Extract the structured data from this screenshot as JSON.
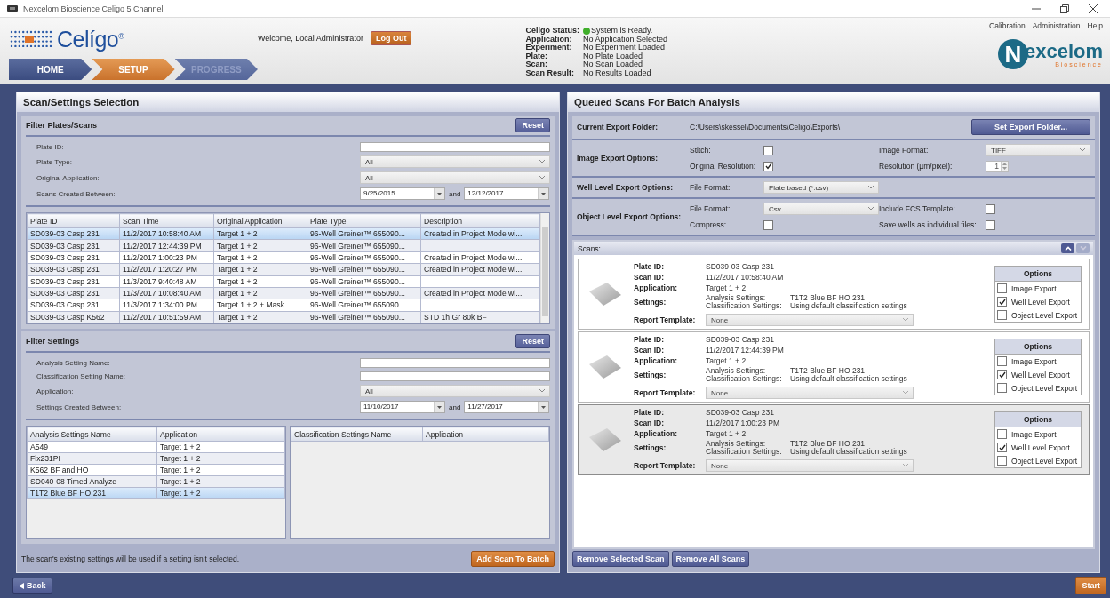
{
  "window": {
    "title": "Nexcelom Bioscience Celigo 5 Channel"
  },
  "header": {
    "logo": "Celígo",
    "logo_mark": "®",
    "welcome": "Welcome,  Local Administrator",
    "logout": "Log Out",
    "status": [
      {
        "label": "Celigo Status:",
        "value": "System is Ready.",
        "kind": "indicator",
        "color": "#3fae2a"
      },
      {
        "label": "Application:",
        "value": "No Application Selected",
        "kind": "plain"
      },
      {
        "label": "Experiment:",
        "value": "No Experiment Loaded",
        "kind": "plain"
      },
      {
        "label": "Plate:",
        "value": "No Plate Loaded",
        "kind": "plain"
      },
      {
        "label": "Scan:",
        "value": "No Scan Loaded",
        "kind": "plain"
      },
      {
        "label": "Scan Result:",
        "value": "No Results Loaded",
        "kind": "plain"
      }
    ],
    "menu": [
      "Calibration",
      "Administration",
      "Help"
    ],
    "brand": {
      "initial": "N",
      "rest": "excelom",
      "tagline": "Bioscience"
    },
    "tabs": [
      {
        "label": "HOME",
        "selected": false,
        "disabled": false
      },
      {
        "label": "SETUP",
        "selected": true,
        "disabled": false
      },
      {
        "label": "PROGRESS",
        "selected": false,
        "disabled": true
      }
    ]
  },
  "scan_selection": {
    "title": "Scan/Settings Selection",
    "plate_filter": {
      "title": "Filter Plates/Scans",
      "reset": "Reset",
      "fields": [
        {
          "label": "Plate ID:",
          "kind": "text"
        },
        {
          "label": "Plate Type:",
          "kind": "select",
          "value": "All"
        },
        {
          "label": "Original Application:",
          "kind": "select",
          "value": "All"
        },
        {
          "label": "Scans Created Between:",
          "kind": "daterange",
          "from": "9/25/2015",
          "joiner": "and",
          "to": "12/12/2017"
        }
      ],
      "columns": [
        "Plate ID",
        "Scan Time",
        "Original Application",
        "Plate Type",
        "Description"
      ],
      "rows": [
        {
          "cells": [
            "SD039-03 Casp 231",
            "11/2/2017 10:58:40 AM",
            "Target 1 + 2",
            "96-Well Greiner™ 655090...",
            "Created in Project Mode wi..."
          ],
          "selected": true
        },
        {
          "cells": [
            "SD039-03 Casp 231",
            "11/2/2017 12:44:39 PM",
            "Target 1 + 2",
            "96-Well Greiner™ 655090..."
          ],
          "selected": false
        },
        {
          "cells": [
            "SD039-03 Casp 231",
            "11/2/2017 1:00:23 PM",
            "Target 1 + 2",
            "96-Well Greiner™ 655090...",
            "Created in Project Mode wi..."
          ],
          "selected": false
        },
        {
          "cells": [
            "SD039-03 Casp 231",
            "11/2/2017 1:20:27 PM",
            "Target 1 + 2",
            "96-Well Greiner™ 655090...",
            "Created in Project Mode wi..."
          ],
          "selected": false
        },
        {
          "cells": [
            "SD039-03 Casp 231",
            "11/3/2017 9:40:48 AM",
            "Target 1 + 2",
            "96-Well Greiner™ 655090..."
          ],
          "selected": false
        },
        {
          "cells": [
            "SD039-03 Casp 231",
            "11/3/2017 10:08:40 AM",
            "Target 1 + 2",
            "96-Well Greiner™ 655090...",
            "Created in Project Mode wi..."
          ],
          "selected": false
        },
        {
          "cells": [
            "SD039-03 Casp 231",
            "11/3/2017 1:34:00 PM",
            "Target 1 + 2 + Mask",
            "96-Well Greiner™ 655090..."
          ],
          "selected": false
        },
        {
          "cells": [
            "SD039-03 Casp K562",
            "11/2/2017 10:51:59 AM",
            "Target 1 + 2",
            "96-Well Greiner™ 655090...",
            "STD 1h Gr 80k BF"
          ],
          "selected": false
        }
      ]
    },
    "settings_filter": {
      "title": "Filter Settings",
      "reset": "Reset",
      "fields": [
        {
          "label": "Analysis Setting Name:",
          "kind": "text"
        },
        {
          "label": "Classification Setting Name:",
          "kind": "text"
        },
        {
          "label": "Application:",
          "kind": "select",
          "value": "All"
        },
        {
          "label": "Settings Created Between:",
          "kind": "daterange",
          "from": "11/10/2017",
          "joiner": "and",
          "to": "11/27/2017"
        }
      ],
      "analysis_columns": [
        "Analysis Settings Name",
        "Application"
      ],
      "analysis_rows": [
        {
          "cells": [
            "A549",
            "Target 1 + 2"
          ],
          "selected": false
        },
        {
          "cells": [
            "Flx231PI",
            "Target 1 + 2"
          ],
          "selected": false
        },
        {
          "cells": [
            "K562 BF and HO",
            "Target 1 + 2"
          ],
          "selected": false
        },
        {
          "cells": [
            "SD040-08 Timed Analyze",
            "Target 1 + 2"
          ],
          "selected": false
        },
        {
          "cells": [
            "T1T2 Blue BF HO 231",
            "Target 1 + 2"
          ],
          "selected": true
        }
      ],
      "classification_columns": [
        "Classification Settings Name",
        "Application"
      ]
    },
    "note": "The scan's existing settings will be used if a setting isn't selected.",
    "add_button": "Add Scan To Batch"
  },
  "batch": {
    "title": "Queued Scans For Batch Analysis",
    "folder": {
      "label": "Current Export Folder:",
      "path": "C:\\Users\\skessel\\Documents\\Celigo\\Exports\\",
      "button": "Set Export Folder..."
    },
    "image_export": {
      "label": "Image Export Options:",
      "stitch": {
        "label": "Stitch:",
        "checked": false
      },
      "original_resolution": {
        "label": "Original Resolution:",
        "checked": true
      },
      "format": {
        "label": "Image Format:",
        "value": "TIFF"
      },
      "resolution": {
        "label": "Resolution (µm/pixel):",
        "value": "1"
      }
    },
    "well_export": {
      "label": "Well Level Export Options:",
      "format": {
        "label": "File Format:",
        "value": "Plate based (*.csv)"
      }
    },
    "object_export": {
      "label": "Object Level Export Options:",
      "format": {
        "label": "File Format:",
        "value": "Csv"
      },
      "fcs": {
        "label": "Include FCS Template:",
        "checked": false
      },
      "compress": {
        "label": "Compress:",
        "checked": false
      },
      "save_wells": {
        "label": "Save wells as individual files:",
        "checked": false
      }
    },
    "scans_title": "Scans:",
    "scans": [
      {
        "selected": false,
        "rows": [
          {
            "label": "Plate ID:",
            "value": "SD039-03 Casp 231"
          },
          {
            "label": "Scan ID:",
            "value": "11/2/2017 10:58:40 AM"
          },
          {
            "label": "Application:",
            "value": "Target 1 + 2"
          }
        ],
        "settings_label": "Settings:",
        "settings": [
          {
            "label": "Analysis Settings:",
            "value": "T1T2 Blue BF HO 231"
          },
          {
            "label": "Classification Settings:",
            "value": "Using default classification settings"
          }
        ],
        "report_label": "Report Template:",
        "report": "None",
        "options_title": "Options",
        "options": [
          {
            "label": "Image Export",
            "checked": false
          },
          {
            "label": "Well Level Export",
            "checked": true
          },
          {
            "label": "Object Level Export",
            "checked": false
          }
        ]
      },
      {
        "selected": false,
        "rows": [
          {
            "label": "Plate ID:",
            "value": "SD039-03 Casp 231"
          },
          {
            "label": "Scan ID:",
            "value": "11/2/2017 12:44:39 PM"
          },
          {
            "label": "Application:",
            "value": "Target 1 + 2"
          }
        ],
        "settings_label": "Settings:",
        "settings": [
          {
            "label": "Analysis Settings:",
            "value": "T1T2 Blue BF HO 231"
          },
          {
            "label": "Classification Settings:",
            "value": "Using default classification settings"
          }
        ],
        "report_label": "Report Template:",
        "report": "None",
        "options_title": "Options",
        "options": [
          {
            "label": "Image Export",
            "checked": false
          },
          {
            "label": "Well Level Export",
            "checked": true
          },
          {
            "label": "Object Level Export",
            "checked": false
          }
        ]
      },
      {
        "selected": true,
        "rows": [
          {
            "label": "Plate ID:",
            "value": "SD039-03 Casp 231"
          },
          {
            "label": "Scan ID:",
            "value": "11/2/2017 1:00:23 PM"
          },
          {
            "label": "Application:",
            "value": "Target 1 + 2"
          }
        ],
        "settings_label": "Settings:",
        "settings": [
          {
            "label": "Analysis Settings:",
            "value": "T1T2 Blue BF HO 231"
          },
          {
            "label": "Classification Settings:",
            "value": "Using default classification settings"
          }
        ],
        "report_label": "Report Template:",
        "report": "None",
        "options_title": "Options",
        "options": [
          {
            "label": "Image Export",
            "checked": false
          },
          {
            "label": "Well Level Export",
            "checked": true
          },
          {
            "label": "Object Level Export",
            "checked": false
          }
        ]
      }
    ],
    "buttons": [
      "Remove Selected Scan",
      "Remove All Scans"
    ]
  },
  "footer": {
    "back": "Back",
    "start": "Start"
  }
}
